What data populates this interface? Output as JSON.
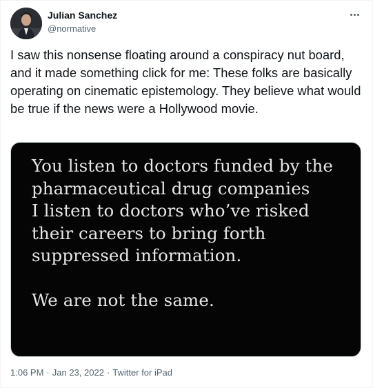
{
  "author": {
    "name": "Julian Sanchez",
    "handle": "@normative"
  },
  "tweet": {
    "text": "I saw this nonsense floating around a conspiracy nut board, and it made something click for me: These folks are basically operating on cinematic epistemology. They believe what would be true if the news were a Hollywood movie."
  },
  "media": {
    "text": "You listen to doctors funded by the\npharmaceutical drug companies\nI listen to doctors who’ve risked\ntheir careers to bring forth\nsuppressed information.\n\nWe are not the same."
  },
  "meta": {
    "time": "1:06 PM",
    "separator1": "·",
    "date": "Jan 23, 2022",
    "separator2": "·",
    "source": "Twitter for iPad"
  },
  "icons": {
    "more": "more-horizontal-icon"
  }
}
